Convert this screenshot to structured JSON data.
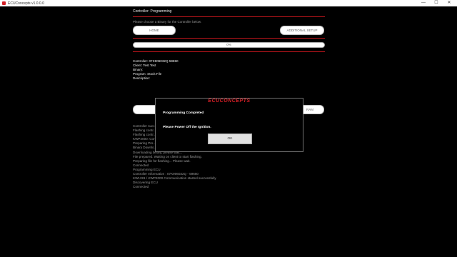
{
  "window": {
    "title": "ECUConcepts v1.0.0.0",
    "minimize": "—",
    "maximize": "☐",
    "close": "✕"
  },
  "header": {
    "section_title": "Controller: Programming",
    "subtitle": "Please choose a Binary for the Controller below.",
    "home_label": "HOME",
    "additional_setup_label": "ADDITIONAL SETUP"
  },
  "progress": {
    "value": 0,
    "text": "0%"
  },
  "info": [
    "Controller: 07K906032Q 59650",
    "Client: Test Test",
    "Binary:",
    "Program: Stock File",
    "Description:"
  ],
  "row_buttons": {
    "right_fragment": "RAM"
  },
  "log": [
    "Controller succ...",
    "Flashing contr...",
    "Flashing contr...",
    "KWP2000: Con...",
    "Preparing Pro...",
    "Binary Downlo...",
    "Downloading binary, please wait...",
    "File prepared. Waiting on client to start flashing.",
    "Preparing file for flashing... Please wait.",
    "Connected",
    "Programming ECU",
    "Controller Information : 07K906032Q - 59650",
    "KW1281 / KWP2000 Communication started successfully",
    "Discovering ECU",
    "Connected"
  ],
  "modal": {
    "brand": "ECUCONCEPTS",
    "heading": "Programming Completed",
    "message": "Please Power Off the Ignition.",
    "ok_label": "OK"
  },
  "colors": {
    "accent": "#c4161c",
    "background": "#000000"
  }
}
